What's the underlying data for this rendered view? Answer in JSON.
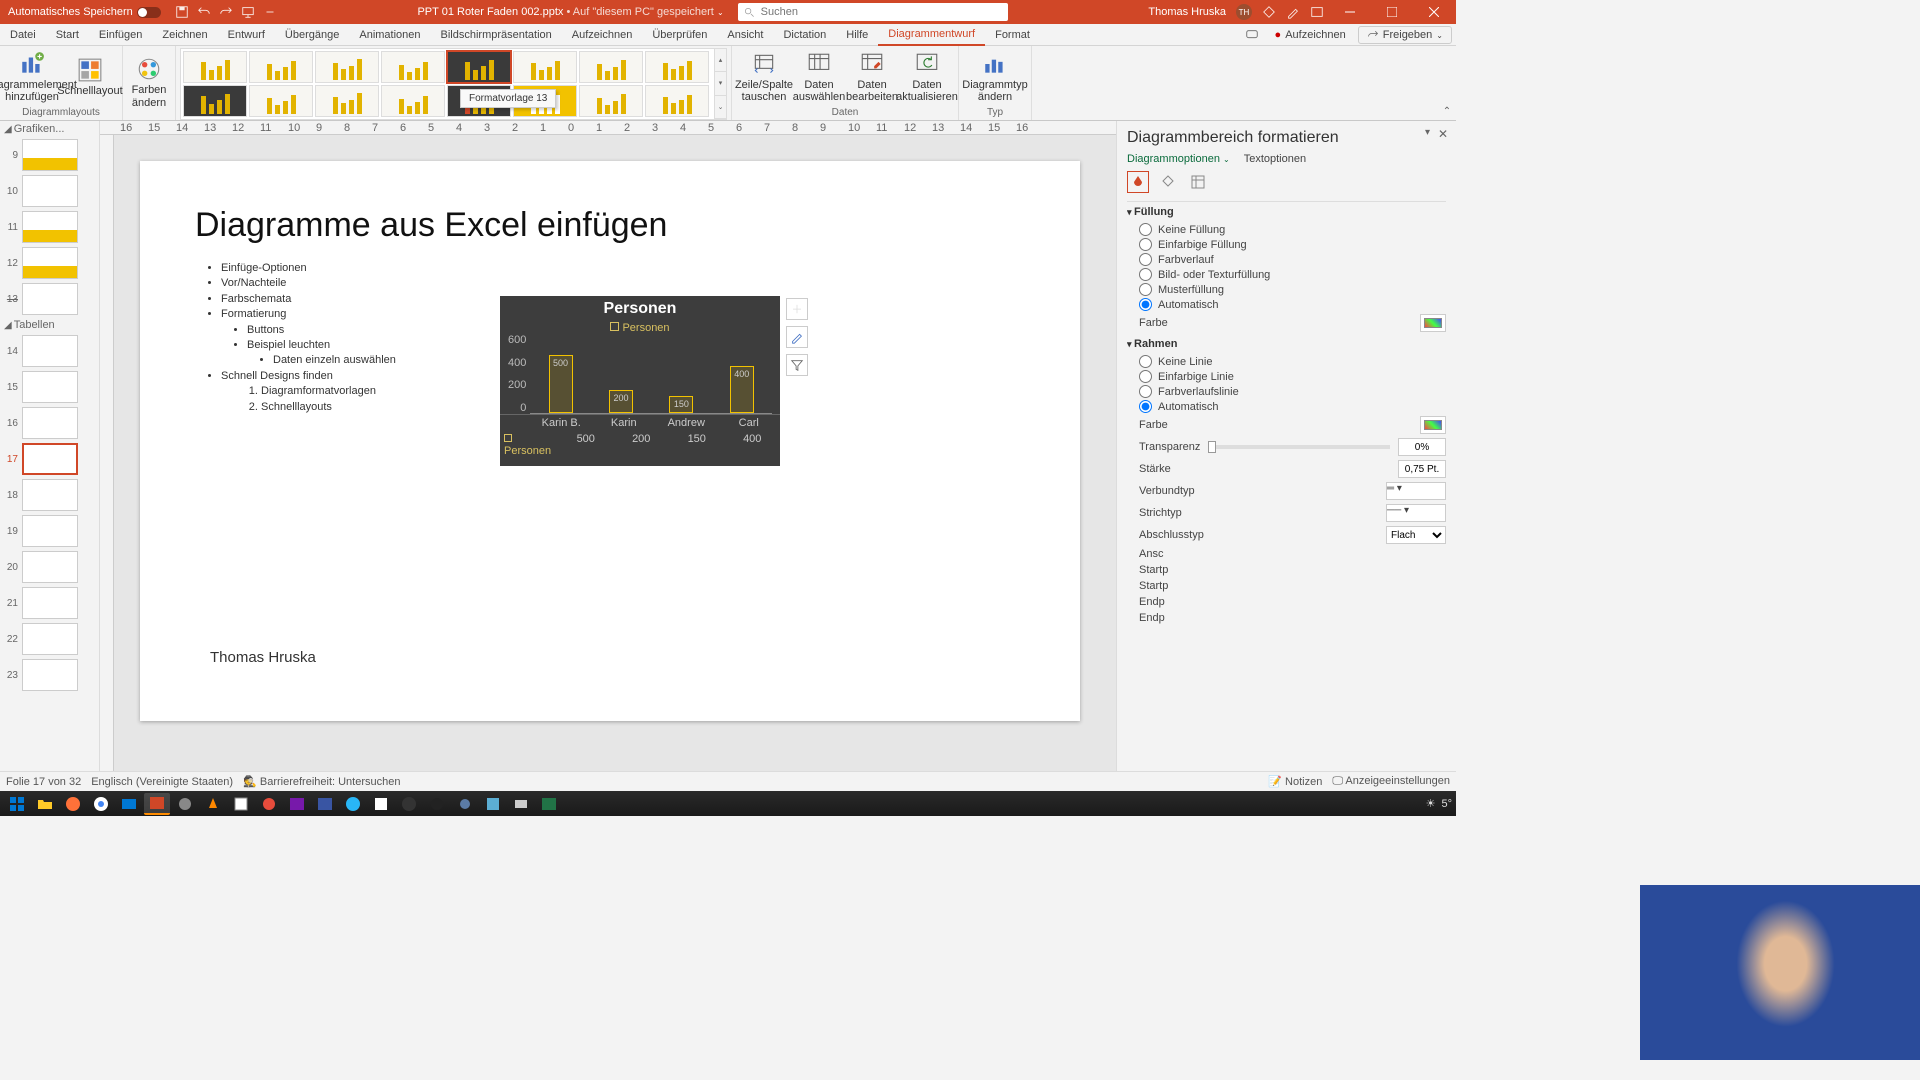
{
  "titlebar": {
    "autosave": "Automatisches Speichern",
    "filename": "PPT 01 Roter Faden 002.pptx",
    "saved_hint": "• Auf \"diesem PC\" gespeichert",
    "search_placeholder": "Suchen",
    "user": "Thomas Hruska",
    "initials": "TH"
  },
  "tabs": {
    "items": [
      "Datei",
      "Start",
      "Einfügen",
      "Zeichnen",
      "Entwurf",
      "Übergänge",
      "Animationen",
      "Bildschirmpräsentation",
      "Aufzeichnen",
      "Überprüfen",
      "Ansicht",
      "Dictation",
      "Hilfe",
      "Diagrammentwurf",
      "Format"
    ],
    "record": "Aufzeichnen",
    "share": "Freigeben"
  },
  "ribbon": {
    "add_element": "Diagrammelement hinzufügen",
    "quick_layout": "Schnelllayout",
    "layouts_label": "Diagrammlayouts",
    "colors": "Farben ändern",
    "tooltip": "Formatvorlage 13",
    "swap": "Zeile/Spalte tauschen",
    "select_data": "Daten auswählen",
    "edit_data": "Daten bearbeiten",
    "refresh": "Daten aktualisieren",
    "data_label": "Daten",
    "change_type": "Diagrammtyp ändern",
    "type_label": "Typ"
  },
  "thumbs": {
    "section_graphics": "Grafiken...",
    "section_tables": "Tabellen"
  },
  "ruler": {
    "marks": [
      16,
      15,
      14,
      13,
      12,
      11,
      10,
      9,
      8,
      7,
      6,
      5,
      4,
      3,
      2,
      1,
      0,
      1,
      2,
      3,
      4,
      5,
      6,
      7,
      8,
      9,
      10,
      11,
      12,
      13,
      14,
      15,
      16
    ]
  },
  "slide": {
    "title": "Diagramme aus Excel einfügen",
    "bullets": {
      "b1": "Einfüge-Optionen",
      "b2": "Vor/Nachteile",
      "b3": "Farbschemata",
      "b4": "Formatierung",
      "b4a": "Buttons",
      "b4b": "Beispiel leuchten",
      "b4b1": "Daten einzeln auswählen",
      "b5": "Schnell Designs finden",
      "b5_1": "Diagramformatvorlagen",
      "b5_2": "Schnelllayouts"
    },
    "author": "Thomas Hruska"
  },
  "chart_data": {
    "type": "bar",
    "title": "Personen",
    "legend": "Personen",
    "ylabel": "",
    "ylim": [
      0,
      600
    ],
    "yticks": [
      0,
      200,
      400,
      600
    ],
    "categories": [
      "Karin B.",
      "Karin",
      "Andrew",
      "Carl"
    ],
    "values": [
      500,
      200,
      150,
      400
    ],
    "data_row_label": "Personen"
  },
  "pane": {
    "title": "Diagrammbereich formatieren",
    "tab_options": "Diagrammoptionen",
    "tab_text": "Textoptionen",
    "fill": {
      "header": "Füllung",
      "none": "Keine Füllung",
      "solid": "Einfarbige Füllung",
      "gradient": "Farbverlauf",
      "picture": "Bild- oder Texturfüllung",
      "pattern": "Musterfüllung",
      "auto": "Automatisch",
      "color": "Farbe"
    },
    "border": {
      "header": "Rahmen",
      "none": "Keine Linie",
      "solid": "Einfarbige Linie",
      "gradient": "Farbverlaufslinie",
      "auto": "Automatisch",
      "color": "Farbe",
      "transparency": "Transparenz",
      "transparency_val": "0%",
      "width": "Stärke",
      "width_val": "0,75 Pt.",
      "compound": "Verbundtyp",
      "dash": "Strichtyp",
      "cap": "Abschlusstyp",
      "cap_val": "Flach",
      "join": "Ansc",
      "begin_arrow": "Startp",
      "begin_size": "Startp",
      "end_arrow": "Endp",
      "end_size": "Endp"
    }
  },
  "status": {
    "slide": "Folie 17 von 32",
    "lang": "Englisch (Vereinigte Staaten)",
    "access": "Barrierefreiheit: Untersuchen",
    "notes": "Notizen",
    "display": "Anzeigeeinstellungen"
  },
  "taskbar": {
    "temp": "5°"
  }
}
